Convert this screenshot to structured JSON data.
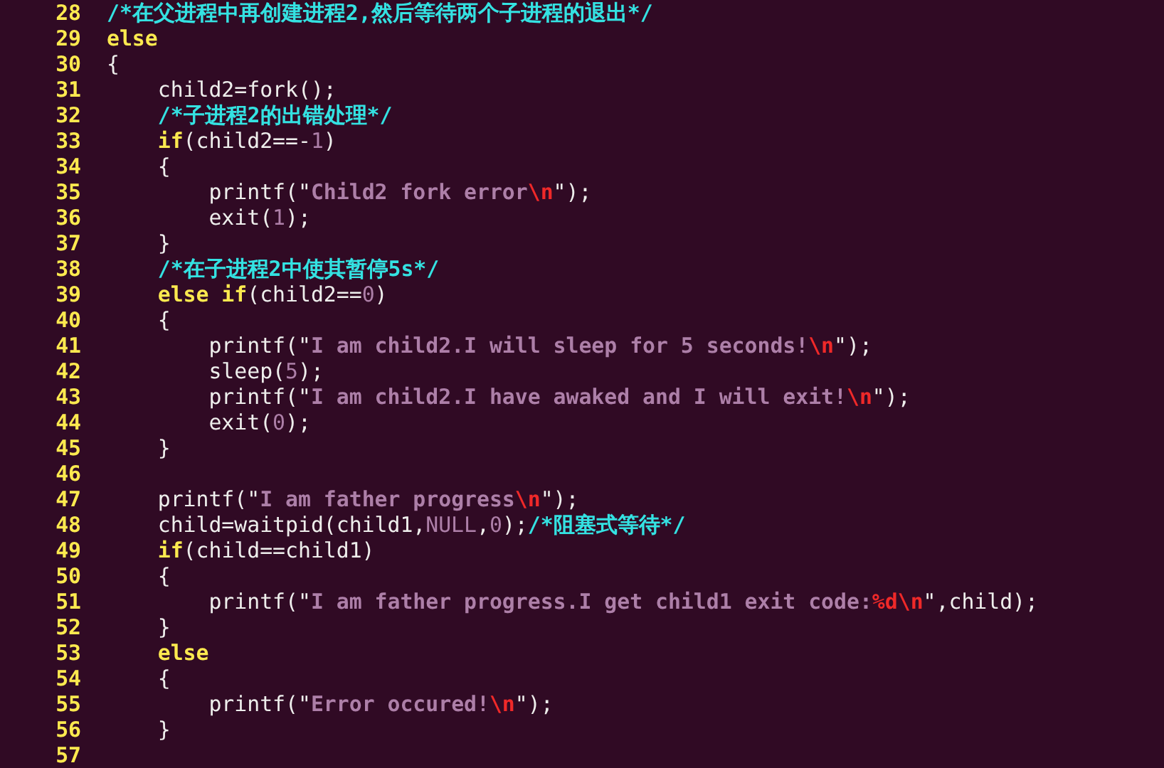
{
  "editor": {
    "lines": [
      {
        "number": "28",
        "tokens": [
          {
            "kind": "comment",
            "text": "/*在父进程中再创建进程2,然后等待两个子进程的退出*/"
          }
        ]
      },
      {
        "number": "29",
        "tokens": [
          {
            "kind": "keyword",
            "text": "else"
          }
        ]
      },
      {
        "number": "30",
        "tokens": [
          {
            "kind": "plain",
            "text": "{"
          }
        ]
      },
      {
        "number": "31",
        "tokens": [
          {
            "kind": "plain",
            "text": "    child2=fork();"
          }
        ]
      },
      {
        "number": "32",
        "tokens": [
          {
            "kind": "comment",
            "text": "    /*子进程2的出错处理*/"
          }
        ]
      },
      {
        "number": "33",
        "tokens": [
          {
            "kind": "keyword",
            "text": "    if"
          },
          {
            "kind": "plain",
            "text": "(child2==-"
          },
          {
            "kind": "number",
            "text": "1"
          },
          {
            "kind": "plain",
            "text": ")"
          }
        ]
      },
      {
        "number": "34",
        "tokens": [
          {
            "kind": "plain",
            "text": "    {"
          }
        ]
      },
      {
        "number": "35",
        "tokens": [
          {
            "kind": "plain",
            "text": "        printf(\""
          },
          {
            "kind": "string",
            "text": "Child2 fork error"
          },
          {
            "kind": "escape",
            "text": "\\n"
          },
          {
            "kind": "plain",
            "text": "\");"
          }
        ]
      },
      {
        "number": "36",
        "tokens": [
          {
            "kind": "plain",
            "text": "        exit("
          },
          {
            "kind": "number",
            "text": "1"
          },
          {
            "kind": "plain",
            "text": ");"
          }
        ]
      },
      {
        "number": "37",
        "tokens": [
          {
            "kind": "plain",
            "text": "    }"
          }
        ]
      },
      {
        "number": "38",
        "tokens": [
          {
            "kind": "comment",
            "text": "    /*在子进程2中使其暂停5s*/"
          }
        ]
      },
      {
        "number": "39",
        "tokens": [
          {
            "kind": "keyword",
            "text": "    else if"
          },
          {
            "kind": "plain",
            "text": "(child2=="
          },
          {
            "kind": "number",
            "text": "0"
          },
          {
            "kind": "plain",
            "text": ")"
          }
        ]
      },
      {
        "number": "40",
        "tokens": [
          {
            "kind": "plain",
            "text": "    {"
          }
        ]
      },
      {
        "number": "41",
        "tokens": [
          {
            "kind": "plain",
            "text": "        printf(\""
          },
          {
            "kind": "string",
            "text": "I am child2.I will sleep for 5 seconds!"
          },
          {
            "kind": "escape",
            "text": "\\n"
          },
          {
            "kind": "plain",
            "text": "\");"
          }
        ]
      },
      {
        "number": "42",
        "tokens": [
          {
            "kind": "plain",
            "text": "        sleep("
          },
          {
            "kind": "number",
            "text": "5"
          },
          {
            "kind": "plain",
            "text": ");"
          }
        ]
      },
      {
        "number": "43",
        "tokens": [
          {
            "kind": "plain",
            "text": "        printf(\""
          },
          {
            "kind": "string",
            "text": "I am child2.I have awaked and I will exit!"
          },
          {
            "kind": "escape",
            "text": "\\n"
          },
          {
            "kind": "plain",
            "text": "\");"
          }
        ]
      },
      {
        "number": "44",
        "tokens": [
          {
            "kind": "plain",
            "text": "        exit("
          },
          {
            "kind": "number",
            "text": "0"
          },
          {
            "kind": "plain",
            "text": ");"
          }
        ]
      },
      {
        "number": "45",
        "tokens": [
          {
            "kind": "plain",
            "text": "    }"
          }
        ]
      },
      {
        "number": "46"
      },
      {
        "number": "47",
        "tokens": [
          {
            "kind": "plain",
            "text": "    printf(\""
          },
          {
            "kind": "string",
            "text": "I am father progress"
          },
          {
            "kind": "escape",
            "text": "\\n"
          },
          {
            "kind": "plain",
            "text": "\");"
          }
        ]
      },
      {
        "number": "48",
        "tokens": [
          {
            "kind": "plain",
            "text": "    child=waitpid(child1,"
          },
          {
            "kind": "constant",
            "text": "NULL"
          },
          {
            "kind": "plain",
            "text": ","
          },
          {
            "kind": "number",
            "text": "0"
          },
          {
            "kind": "plain",
            "text": ");"
          },
          {
            "kind": "comment",
            "text": "/*阻塞式等待*/"
          }
        ]
      },
      {
        "number": "49",
        "tokens": [
          {
            "kind": "keyword",
            "text": "    if"
          },
          {
            "kind": "plain",
            "text": "(child==child1)"
          }
        ]
      },
      {
        "number": "50",
        "tokens": [
          {
            "kind": "plain",
            "text": "    {"
          }
        ]
      },
      {
        "number": "51",
        "tokens": [
          {
            "kind": "plain",
            "text": "        printf(\""
          },
          {
            "kind": "string",
            "text": "I am father progress.I get child1 exit code:"
          },
          {
            "kind": "escape",
            "text": "%d\\n"
          },
          {
            "kind": "plain",
            "text": "\",child);"
          }
        ]
      },
      {
        "number": "52",
        "tokens": [
          {
            "kind": "plain",
            "text": "    }"
          }
        ]
      },
      {
        "number": "53",
        "tokens": [
          {
            "kind": "keyword",
            "text": "    else"
          }
        ]
      },
      {
        "number": "54",
        "tokens": [
          {
            "kind": "plain",
            "text": "    {"
          }
        ]
      },
      {
        "number": "55",
        "tokens": [
          {
            "kind": "plain",
            "text": "        printf(\""
          },
          {
            "kind": "string",
            "text": "Error occured!"
          },
          {
            "kind": "escape",
            "text": "\\n"
          },
          {
            "kind": "plain",
            "text": "\");"
          }
        ]
      },
      {
        "number": "56",
        "tokens": [
          {
            "kind": "plain",
            "text": "    }"
          }
        ]
      },
      {
        "number": "57"
      }
    ]
  }
}
